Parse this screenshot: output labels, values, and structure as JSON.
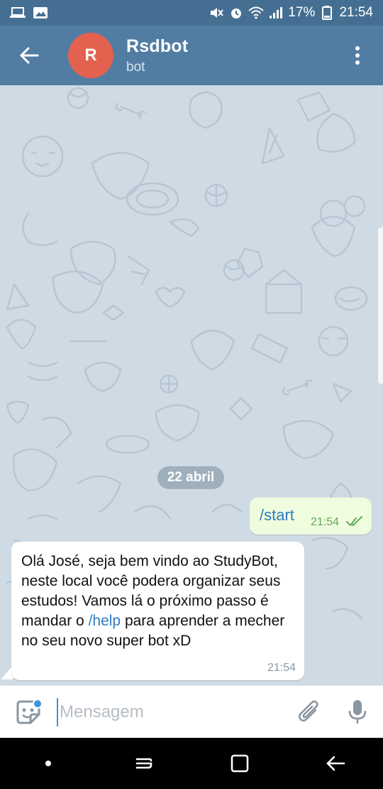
{
  "status_bar": {
    "battery_percent": "17%",
    "time": "21:54",
    "icons": [
      "laptop-icon",
      "gallery-icon",
      "mute-icon",
      "alarm-icon",
      "wifi-icon",
      "signal-icon",
      "battery-icon"
    ]
  },
  "header": {
    "avatar_initial": "R",
    "title": "Rsdbot",
    "subtitle": "bot",
    "colors": {
      "bar": "#527da3",
      "status": "#456f92",
      "avatar": "#e3614f"
    }
  },
  "chat": {
    "date_label": "22 abril",
    "messages": [
      {
        "direction": "outgoing",
        "text": "/start",
        "time": "21:54",
        "read": true
      },
      {
        "direction": "incoming",
        "parts": {
          "before": "Olá José, seja bem vindo ao StudyBot, neste local você podera organizar seus estudos! Vamos lá o próximo passo é mandar o ",
          "command": "/help",
          "after": " para aprender a mecher no seu novo super bot xD"
        },
        "time": "21:54"
      }
    ]
  },
  "input": {
    "placeholder": "Mensagem",
    "value": ""
  },
  "navbar": {
    "icons": [
      "dot-icon",
      "recents-icon",
      "home-icon",
      "back-nav-icon"
    ]
  }
}
